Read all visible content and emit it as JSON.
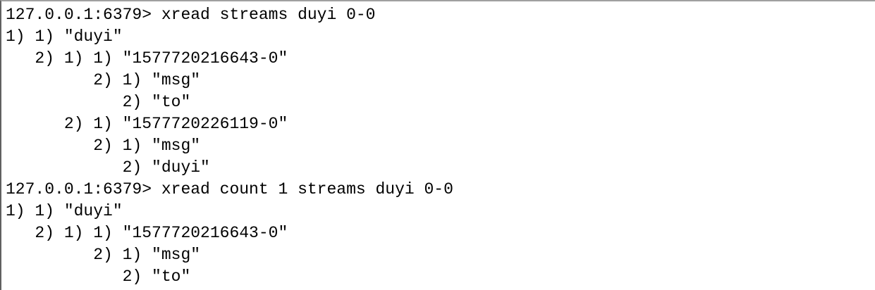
{
  "terminal": {
    "lines": [
      "127.0.0.1:6379> xread streams duyi 0-0",
      "1) 1) \"duyi\"",
      "   2) 1) 1) \"1577720216643-0\"",
      "         2) 1) \"msg\"",
      "            2) \"to\"",
      "      2) 1) \"1577720226119-0\"",
      "         2) 1) \"msg\"",
      "            2) \"duyi\"",
      "127.0.0.1:6379> xread count 1 streams duyi 0-0",
      "1) 1) \"duyi\"",
      "   2) 1) 1) \"1577720216643-0\"",
      "         2) 1) \"msg\"",
      "            2) \"to\""
    ]
  }
}
